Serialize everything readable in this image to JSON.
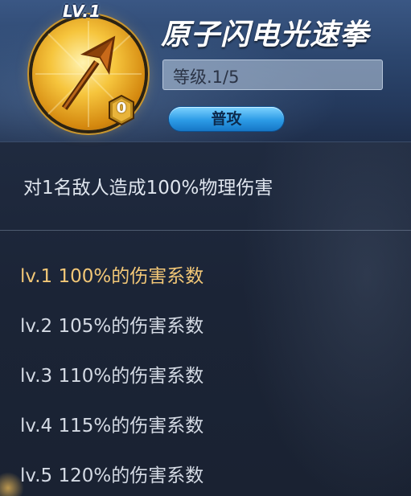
{
  "skill": {
    "level_badge": "LV.1",
    "name": "原子闪电光速拳",
    "level_text": "等级.1/5",
    "type_label": "普攻",
    "counter": "0",
    "icon": "golden-arrow-medallion-icon"
  },
  "description": "对1名敌人造成100%物理伤害",
  "levels": [
    {
      "label": "lv.1 100%的伤害系数",
      "active": true
    },
    {
      "label": "lv.2 105%的伤害系数",
      "active": false
    },
    {
      "label": "lv.3 110%的伤害系数",
      "active": false
    },
    {
      "label": "lv.4 115%的伤害系数",
      "active": false
    },
    {
      "label": "lv.5 120%的伤害系数",
      "active": false
    }
  ],
  "colors": {
    "active_level": "#f2c777",
    "inactive_level": "#d4dae4",
    "pill_blue": "#2c9be6",
    "medal_gold": "#f6c53d"
  }
}
